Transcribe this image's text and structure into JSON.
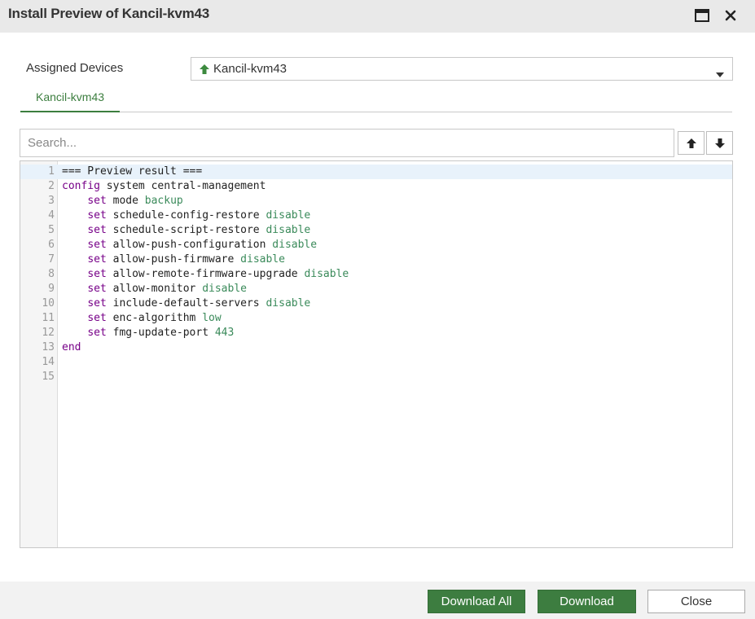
{
  "window": {
    "title": "Install Preview of Kancil-kvm43"
  },
  "assigned": {
    "label": "Assigned Devices",
    "selected_device": "Kancil-kvm43"
  },
  "tabs": [
    {
      "label": "Kancil-kvm43",
      "active": true
    }
  ],
  "search": {
    "placeholder": "Search..."
  },
  "editor": {
    "active_line": 1,
    "lines": [
      [
        {
          "t": "=== Preview result ===",
          "c": ""
        }
      ],
      [
        {
          "t": "config",
          "c": "kw"
        },
        {
          "t": " system central-management",
          "c": ""
        }
      ],
      [
        {
          "t": "    ",
          "c": ""
        },
        {
          "t": "set",
          "c": "kw"
        },
        {
          "t": " mode ",
          "c": ""
        },
        {
          "t": "backup",
          "c": "val"
        }
      ],
      [
        {
          "t": "    ",
          "c": ""
        },
        {
          "t": "set",
          "c": "kw"
        },
        {
          "t": " schedule-config-restore ",
          "c": ""
        },
        {
          "t": "disable",
          "c": "val"
        }
      ],
      [
        {
          "t": "    ",
          "c": ""
        },
        {
          "t": "set",
          "c": "kw"
        },
        {
          "t": " schedule-script-restore ",
          "c": ""
        },
        {
          "t": "disable",
          "c": "val"
        }
      ],
      [
        {
          "t": "    ",
          "c": ""
        },
        {
          "t": "set",
          "c": "kw"
        },
        {
          "t": " allow-push-configuration ",
          "c": ""
        },
        {
          "t": "disable",
          "c": "val"
        }
      ],
      [
        {
          "t": "    ",
          "c": ""
        },
        {
          "t": "set",
          "c": "kw"
        },
        {
          "t": " allow-push-firmware ",
          "c": ""
        },
        {
          "t": "disable",
          "c": "val"
        }
      ],
      [
        {
          "t": "    ",
          "c": ""
        },
        {
          "t": "set",
          "c": "kw"
        },
        {
          "t": " allow-remote-firmware-upgrade ",
          "c": ""
        },
        {
          "t": "disable",
          "c": "val"
        }
      ],
      [
        {
          "t": "    ",
          "c": ""
        },
        {
          "t": "set",
          "c": "kw"
        },
        {
          "t": " allow-monitor ",
          "c": ""
        },
        {
          "t": "disable",
          "c": "val"
        }
      ],
      [
        {
          "t": "    ",
          "c": ""
        },
        {
          "t": "set",
          "c": "kw"
        },
        {
          "t": " include-default-servers ",
          "c": ""
        },
        {
          "t": "disable",
          "c": "val"
        }
      ],
      [
        {
          "t": "    ",
          "c": ""
        },
        {
          "t": "set",
          "c": "kw"
        },
        {
          "t": " enc-algorithm ",
          "c": ""
        },
        {
          "t": "low",
          "c": "val"
        }
      ],
      [
        {
          "t": "    ",
          "c": ""
        },
        {
          "t": "set",
          "c": "kw"
        },
        {
          "t": " fmg-update-port ",
          "c": ""
        },
        {
          "t": "443",
          "c": "val"
        }
      ],
      [
        {
          "t": "end",
          "c": "kw"
        }
      ],
      [],
      []
    ]
  },
  "footer": {
    "download_all": "Download All",
    "download": "Download",
    "close": "Close"
  },
  "icons": {
    "maximize": "maximize-icon",
    "close": "close-icon",
    "device_status": "arrow-up-icon",
    "dropdown": "caret-down-icon",
    "prev": "arrow-up-icon",
    "next": "arrow-down-icon"
  },
  "colors": {
    "accent": "#3d7d40",
    "keyword": "#770088",
    "value": "#3a8a5a",
    "active_line": "#e8f2fb"
  }
}
